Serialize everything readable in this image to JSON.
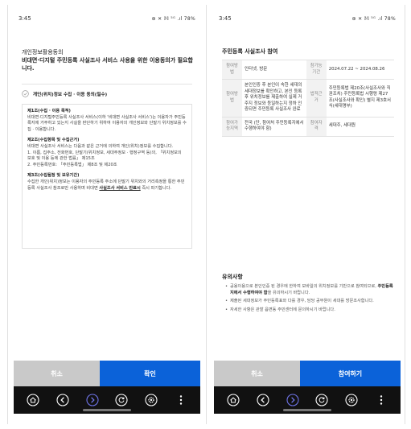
{
  "left": {
    "status": {
      "time": "3:45",
      "icons": "⊛ ✕ 𝕄 ⁵ᴳ .ıl 78%",
      "battery": "78%"
    },
    "consent_line1": "개인정보활용동의",
    "consent_line2": "비대면·디지털 주민등록 사실조사 서비스 사용을 위한 이용동의가 필요합니다.",
    "check_label": "개인(위치)정보 수집 · 이용 동의(필수)",
    "terms": {
      "h1": "제1조(수집 · 이용 목적)",
      "p1": "비대면·디지털주민등록 사실조사 서비스(이하 '비대면 사실조사 서비스')는 이용자가 주민등록지에 거주하고 있는지 사실을 판단하기 위하여 이용자의 개인정보와 단말기 위치정보를 수집 · 이용합니다.",
      "h2": "제2조(수집항목 및 수집근거)",
      "p2": "비대면 사실조사 서비스는 다음과 같은 근거에 의하여 개인(위치)정보를 수집합니다.",
      "p3": "1. 이름, 집주소, 전화번호, 단말기(위치정보, 세대주정보 · 행정구역 등)의, 「위치정보의 보호 및 이용 등에 관한 법률」 제15조",
      "p4": "2. 주민등록번호: 「주민등록법」 제8조 및 제20조",
      "h3": "제3조(수집될정 및 보유기간)",
      "p5": "수집한 개인(위치)정보는 이용자의 주민등록 주소에 단말기 위치와의 거리측정을 통한 주민등록 사실조사 참조로만 사용하며 비대면 ",
      "p5u": "사실조사 서비스 만료시",
      "p5e": " 즉시 파기합니다."
    },
    "buttons": {
      "cancel": "취소",
      "confirm": "확인"
    }
  },
  "right": {
    "status": {
      "time": "3:45",
      "icons": "⊛ ✕ 𝕄 ⁵ᴳ .ıl 78%"
    },
    "section_title": "주민등록 사실조사 참여",
    "table": {
      "r1": {
        "k1": "참여방법",
        "v1": "인터넷, 방문",
        "k2": "참가능기간",
        "v2": "2024.07.22 ~ 2024.08.26"
      },
      "r2": {
        "k1": "참여방법",
        "v1": "본인인증 후 본인이 속한 세대의 세대정보를 확인하고, 본인 등록 후 위치정보를 제출하여 실제 거주지 정보와 등일하는지 정하 인증되면 주민등록 사실조사 완료",
        "k2": "법적근거",
        "v2": "주민등록법 제20조(사실조사와 직권조치) 주민등록법 시행령 제27조(사실조사와 확인) 별지 제3호서식(세대명부)"
      },
      "r3": {
        "k1": "참여가능지역",
        "v1": "전국 (단, 참여처 주민등록지에서 수행하여야 함)",
        "k2": "참여자격",
        "v2": "세대주, 세대원"
      }
    },
    "notice_title": "유의사항",
    "notices": {
      "n1a": "공용이용으로 본인인증 된 경우에 한하여 모바일의 위치정보를 기반으로 참여되므로, ",
      "n1b": "주민등록지에서 수행하여야 함",
      "n1c": "을 유의하시기 바랍니다.",
      "n2": "제출된 세대정보가 주민등록표와 다를 경우, 담당 공무원이 세대를 방문조사합니다.",
      "n3": "자세한 사항은 관할 읍면동 주민센터에 문의하시기 바랍니다."
    },
    "buttons": {
      "cancel": "취소",
      "participate": "참여하기"
    }
  },
  "nav_icons": [
    "home-icon",
    "back-icon",
    "forward-icon",
    "refresh-icon",
    "settings-icon",
    "more-icon"
  ],
  "colors": {
    "primary": "#0b62d9",
    "cancel": "#c9c9c9",
    "navbar": "#111111"
  }
}
